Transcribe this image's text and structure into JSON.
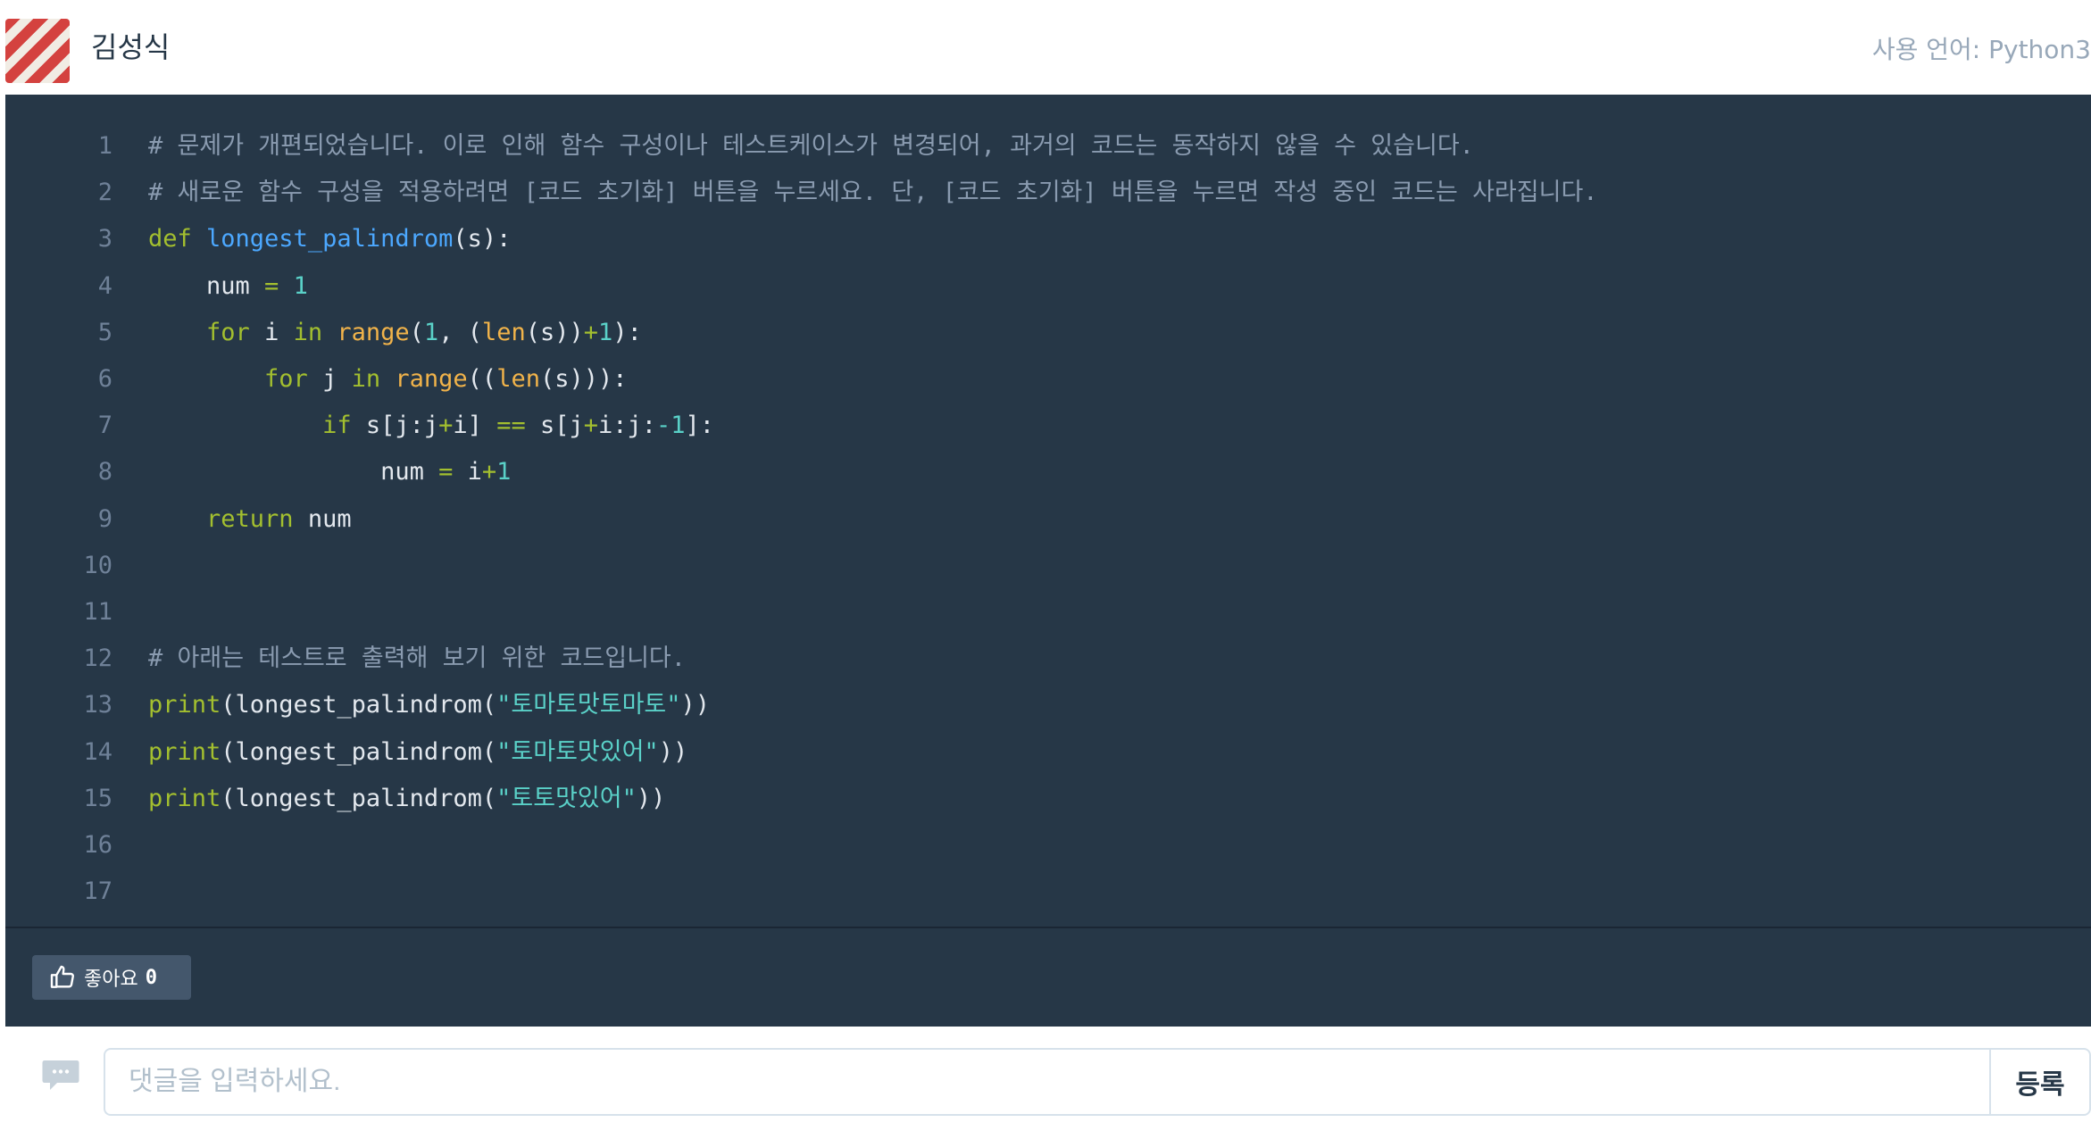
{
  "header": {
    "username": "김성식",
    "language_label": "사용 언어: Python3"
  },
  "code": {
    "lines": [
      {
        "n": "1",
        "tokens": [
          {
            "t": "# 문제가 개편되었습니다. 이로 인해 함수 구성이나 테스트케이스가 변경되어, 과거의 코드는 동작하지 않을 수 있습니다.",
            "c": "comment"
          }
        ]
      },
      {
        "n": "2",
        "tokens": [
          {
            "t": "# 새로운 함수 구성을 적용하려면 [코드 초기화] 버튼을 누르세요. 단, [코드 초기화] 버튼을 누르면 작성 중인 코드는 사라집니다.",
            "c": "comment"
          }
        ]
      },
      {
        "n": "3",
        "tokens": [
          {
            "t": "def ",
            "c": "kw"
          },
          {
            "t": "longest_palindrom",
            "c": "fn"
          },
          {
            "t": "(s):",
            "c": "plain"
          }
        ]
      },
      {
        "n": "4",
        "tokens": [
          {
            "t": "    num ",
            "c": "plain"
          },
          {
            "t": "=",
            "c": "op"
          },
          {
            "t": " ",
            "c": "plain"
          },
          {
            "t": "1",
            "c": "num"
          }
        ]
      },
      {
        "n": "5",
        "tokens": [
          {
            "t": "    ",
            "c": "plain"
          },
          {
            "t": "for",
            "c": "kw"
          },
          {
            "t": " i ",
            "c": "plain"
          },
          {
            "t": "in",
            "c": "kw"
          },
          {
            "t": " ",
            "c": "plain"
          },
          {
            "t": "range",
            "c": "builtin"
          },
          {
            "t": "(",
            "c": "plain"
          },
          {
            "t": "1",
            "c": "num"
          },
          {
            "t": ", (",
            "c": "plain"
          },
          {
            "t": "len",
            "c": "builtin"
          },
          {
            "t": "(s))",
            "c": "plain"
          },
          {
            "t": "+",
            "c": "op"
          },
          {
            "t": "1",
            "c": "num"
          },
          {
            "t": "):",
            "c": "plain"
          }
        ]
      },
      {
        "n": "6",
        "tokens": [
          {
            "t": "        ",
            "c": "plain"
          },
          {
            "t": "for",
            "c": "kw"
          },
          {
            "t": " j ",
            "c": "plain"
          },
          {
            "t": "in",
            "c": "kw"
          },
          {
            "t": " ",
            "c": "plain"
          },
          {
            "t": "range",
            "c": "builtin"
          },
          {
            "t": "((",
            "c": "plain"
          },
          {
            "t": "len",
            "c": "builtin"
          },
          {
            "t": "(s))):",
            "c": "plain"
          }
        ]
      },
      {
        "n": "7",
        "tokens": [
          {
            "t": "            ",
            "c": "plain"
          },
          {
            "t": "if",
            "c": "kw"
          },
          {
            "t": " s[j:j",
            "c": "plain"
          },
          {
            "t": "+",
            "c": "op"
          },
          {
            "t": "i] ",
            "c": "plain"
          },
          {
            "t": "==",
            "c": "op"
          },
          {
            "t": " s[j",
            "c": "plain"
          },
          {
            "t": "+",
            "c": "op"
          },
          {
            "t": "i:j:",
            "c": "plain"
          },
          {
            "t": "-1",
            "c": "num"
          },
          {
            "t": "]:",
            "c": "plain"
          }
        ]
      },
      {
        "n": "8",
        "tokens": [
          {
            "t": "                num ",
            "c": "plain"
          },
          {
            "t": "=",
            "c": "op"
          },
          {
            "t": " i",
            "c": "plain"
          },
          {
            "t": "+",
            "c": "op"
          },
          {
            "t": "1",
            "c": "num"
          }
        ]
      },
      {
        "n": "9",
        "tokens": [
          {
            "t": "    ",
            "c": "plain"
          },
          {
            "t": "return",
            "c": "kw"
          },
          {
            "t": " num",
            "c": "plain"
          }
        ]
      },
      {
        "n": "10",
        "tokens": []
      },
      {
        "n": "11",
        "tokens": []
      },
      {
        "n": "12",
        "tokens": [
          {
            "t": "# 아래는 테스트로 출력해 보기 위한 코드입니다.",
            "c": "comment"
          }
        ]
      },
      {
        "n": "13",
        "tokens": [
          {
            "t": "print",
            "c": "kw"
          },
          {
            "t": "(longest_palindrom(",
            "c": "plain"
          },
          {
            "t": "\"토마토맛토마토\"",
            "c": "str"
          },
          {
            "t": "))",
            "c": "plain"
          }
        ]
      },
      {
        "n": "14",
        "tokens": [
          {
            "t": "print",
            "c": "kw"
          },
          {
            "t": "(longest_palindrom(",
            "c": "plain"
          },
          {
            "t": "\"토마토맛있어\"",
            "c": "str"
          },
          {
            "t": "))",
            "c": "plain"
          }
        ]
      },
      {
        "n": "15",
        "tokens": [
          {
            "t": "print",
            "c": "kw"
          },
          {
            "t": "(longest_palindrom(",
            "c": "plain"
          },
          {
            "t": "\"토토맛있어\"",
            "c": "str"
          },
          {
            "t": "))",
            "c": "plain"
          }
        ]
      },
      {
        "n": "16",
        "tokens": []
      },
      {
        "n": "17",
        "tokens": []
      }
    ]
  },
  "like": {
    "label": "좋아요",
    "count": "0"
  },
  "comment": {
    "placeholder": "댓글을 입력하세요.",
    "submit_label": "등록"
  },
  "colors": {
    "code_bg": "#263747",
    "accent_keyword": "#a3bf2f",
    "function": "#4ca8ff",
    "string": "#5ad1c8"
  }
}
